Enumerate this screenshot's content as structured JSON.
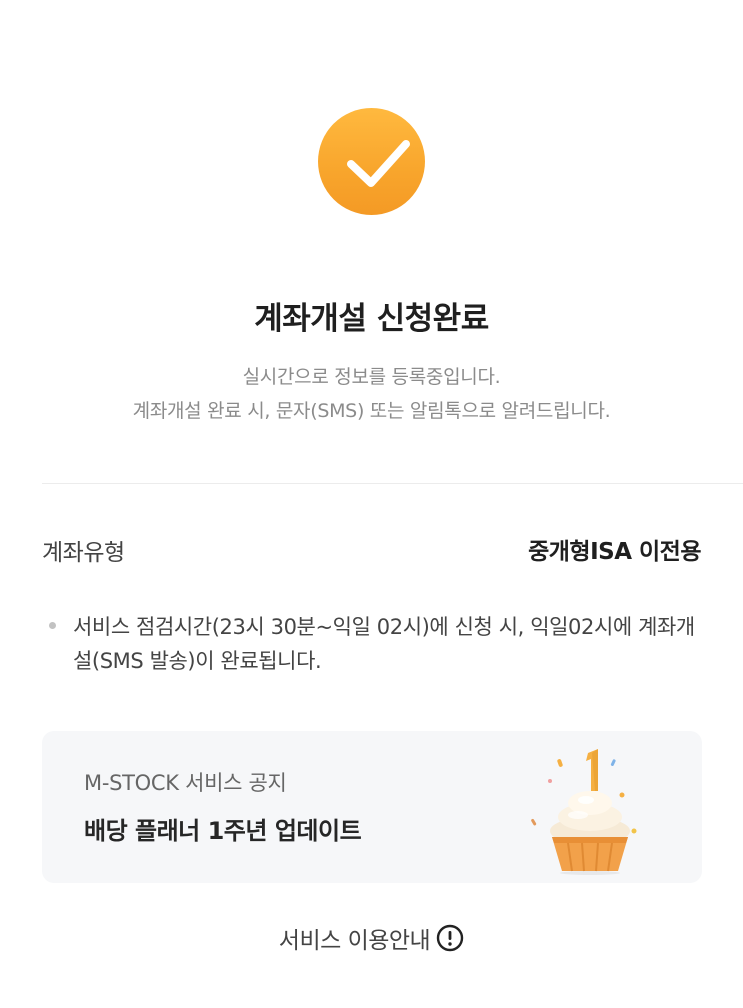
{
  "completion": {
    "icon": "check-circle-icon",
    "accent_color": "#F8A52C",
    "title": "계좌개설 신청완료",
    "subtitle_line1": "실시간으로 정보를 등록중입니다.",
    "subtitle_line2": "계좌개설 완료 시, 문자(SMS) 또는 알림톡으로 알려드립니다."
  },
  "account": {
    "type_label": "계좌유형",
    "type_value": "중개형ISA 이전용"
  },
  "notice": {
    "text": "서비스 점검시간(23시 30분~익일 02시)에 신청 시, 익일02시에 계좌개설(SMS 발송)이  완료됩니다."
  },
  "banner": {
    "small_text": "M-STOCK 서비스 공지",
    "title": "배당 플래너 1주년 업데이트",
    "image": "cupcake-icon"
  },
  "footer": {
    "service_info_label": "서비스 이용안내",
    "icon": "info-icon"
  }
}
